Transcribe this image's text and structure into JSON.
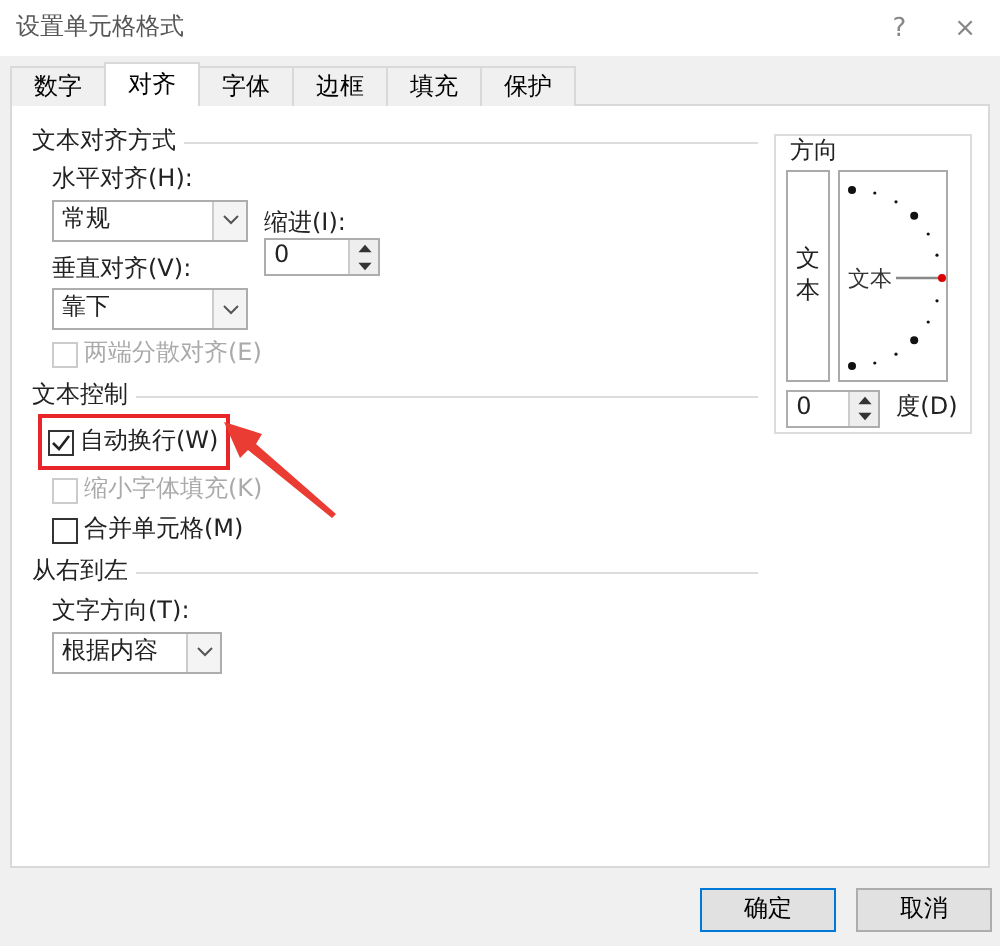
{
  "window": {
    "title": "设置单元格格式",
    "help": "?",
    "close": "×"
  },
  "tabs": [
    {
      "label": "数字",
      "selected": false
    },
    {
      "label": "对齐",
      "selected": true
    },
    {
      "label": "字体",
      "selected": false
    },
    {
      "label": "边框",
      "selected": false
    },
    {
      "label": "填充",
      "selected": false
    },
    {
      "label": "保护",
      "selected": false
    }
  ],
  "text_alignment": {
    "heading": "文本对齐方式",
    "horizontal": {
      "label": "水平对齐(H):",
      "value": "常规"
    },
    "vertical": {
      "label": "垂直对齐(V):",
      "value": "靠下"
    },
    "indent": {
      "label": "缩进(I):",
      "value": "0"
    },
    "distributed": {
      "label": "两端分散对齐(E)",
      "checked": false,
      "disabled": true
    }
  },
  "text_control": {
    "heading": "文本控制",
    "options": [
      {
        "label": "自动换行(W)",
        "checked": true,
        "disabled": false,
        "highlighted": true
      },
      {
        "label": "缩小字体填充(K)",
        "checked": false,
        "disabled": true,
        "highlighted": false
      },
      {
        "label": "合并单元格(M)",
        "checked": false,
        "disabled": false,
        "highlighted": false
      }
    ]
  },
  "right_to_left": {
    "heading": "从右到左",
    "direction": {
      "label": "文字方向(T):",
      "value": "根据内容"
    }
  },
  "orientation": {
    "heading": "方向",
    "vertical_text": "文本",
    "dial_text": "文本",
    "degrees": {
      "value": "0",
      "label": "度(D)"
    }
  },
  "buttons": [
    {
      "label": "确定",
      "default": true
    },
    {
      "label": "取消",
      "default": false
    }
  ]
}
